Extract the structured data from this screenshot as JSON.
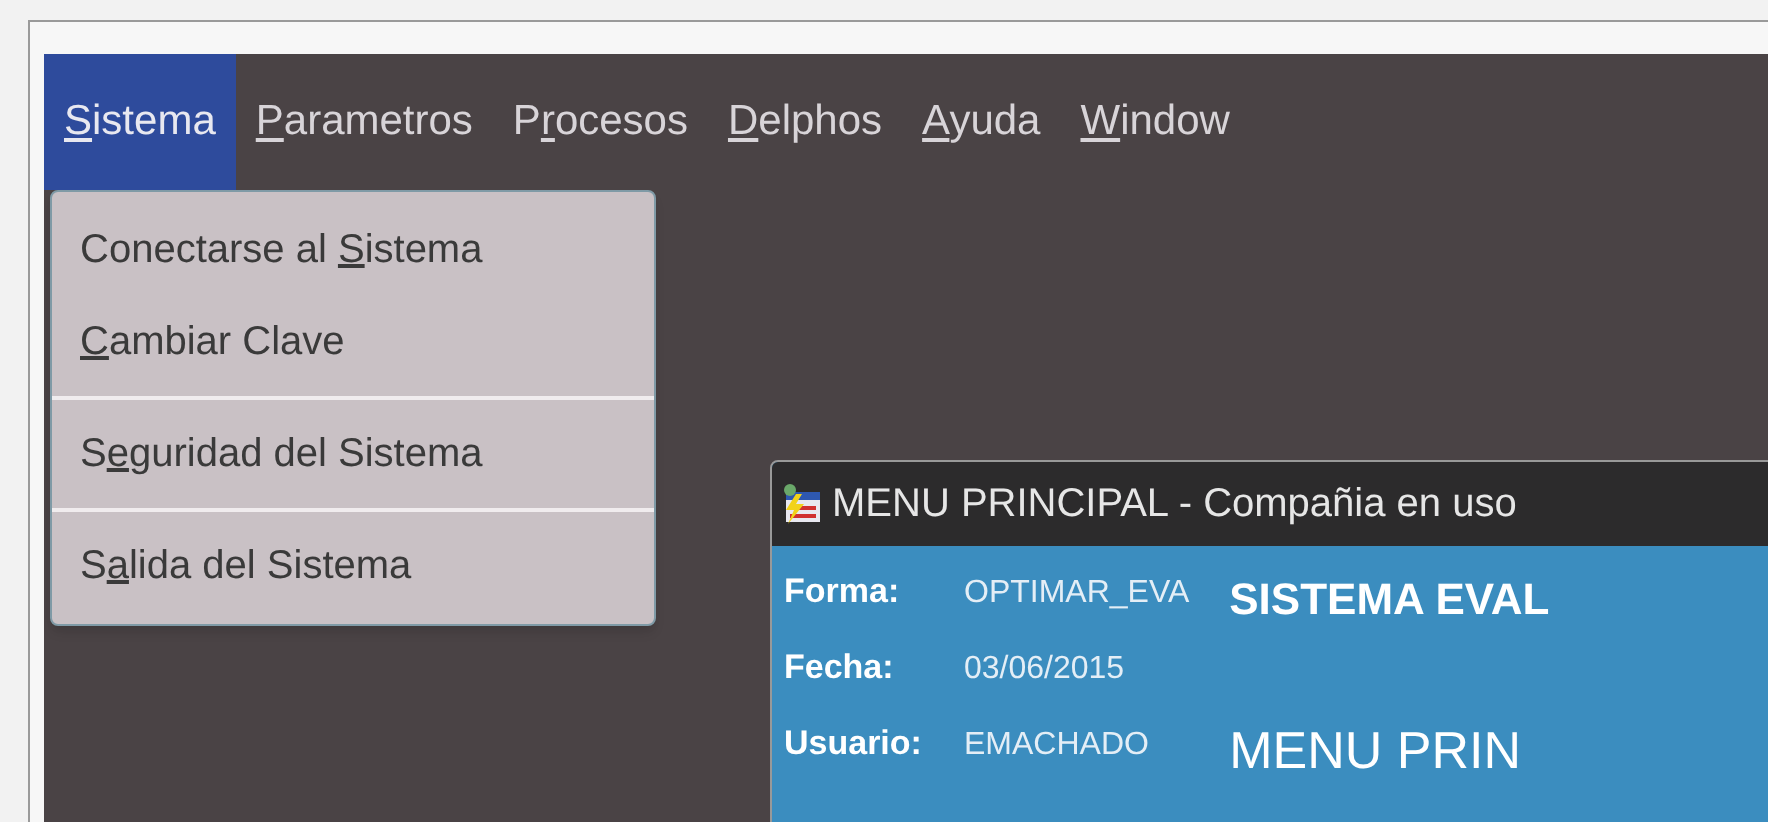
{
  "menu_bar": [
    {
      "runs": [
        {
          "text": "S",
          "underline": true
        },
        {
          "text": "istema",
          "underline": false
        }
      ],
      "selected": true
    },
    {
      "runs": [
        {
          "text": "P",
          "underline": true
        },
        {
          "text": "arametros",
          "underline": false
        }
      ],
      "selected": false
    },
    {
      "runs": [
        {
          "text": "P",
          "underline": false
        },
        {
          "text": "r",
          "underline": true
        },
        {
          "text": "ocesos",
          "underline": false
        }
      ],
      "selected": false
    },
    {
      "runs": [
        {
          "text": "D",
          "underline": true
        },
        {
          "text": "elphos",
          "underline": false
        }
      ],
      "selected": false
    },
    {
      "runs": [
        {
          "text": "A",
          "underline": true
        },
        {
          "text": "yuda",
          "underline": false
        }
      ],
      "selected": false
    },
    {
      "runs": [
        {
          "text": "W",
          "underline": true
        },
        {
          "text": "indow",
          "underline": false
        }
      ],
      "selected": false
    }
  ],
  "dropdown": {
    "groups": [
      [
        {
          "runs": [
            {
              "text": "Conectarse al ",
              "underline": false
            },
            {
              "text": "S",
              "underline": true
            },
            {
              "text": "istema",
              "underline": false
            }
          ]
        },
        {
          "runs": [
            {
              "text": "C",
              "underline": true
            },
            {
              "text": "ambiar Clave",
              "underline": false
            }
          ]
        }
      ],
      [
        {
          "runs": [
            {
              "text": "S",
              "underline": false
            },
            {
              "text": "e",
              "underline": true
            },
            {
              "text": "guridad del Sistema",
              "underline": false
            }
          ]
        }
      ],
      [
        {
          "runs": [
            {
              "text": "S",
              "underline": false
            },
            {
              "text": "a",
              "underline": true
            },
            {
              "text": "lida del Sistema",
              "underline": false
            }
          ]
        }
      ]
    ]
  },
  "inner_window": {
    "title": "MENU PRINCIPAL - Compañia en uso",
    "fields": [
      {
        "label": "Forma:",
        "value": "OPTIMAR_EVA"
      },
      {
        "label": "Fecha:",
        "value": "03/06/2015"
      },
      {
        "label": "Usuario:",
        "value": "EMACHADO"
      }
    ],
    "headings": [
      "SISTEMA EVAL",
      "MENU PRIN"
    ]
  }
}
